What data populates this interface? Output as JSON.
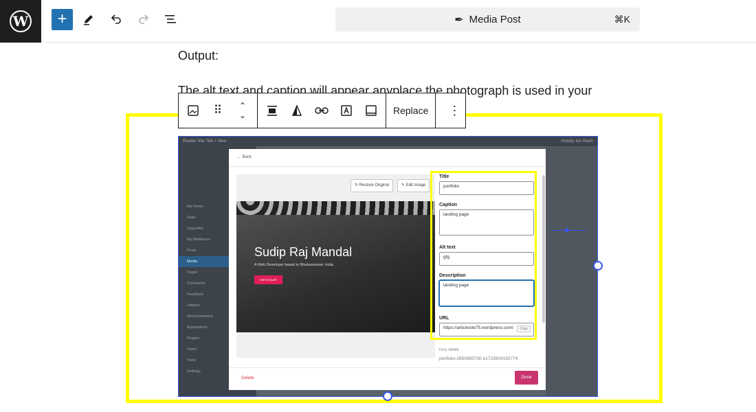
{
  "topbar": {
    "wp_logo": "W",
    "add_label": "+",
    "doc_title": "Media Post",
    "shortcut": "⌘K",
    "icons": [
      "wordpress-icon",
      "add-block-icon",
      "pencil-icon",
      "undo-icon",
      "redo-icon",
      "list-view-icon",
      "feather-icon"
    ]
  },
  "content": {
    "para1": "Output:",
    "para2": "The alt text and caption will appear anyplace the photograph is used in your"
  },
  "block_toolbar": {
    "replace_label": "Replace",
    "icons": [
      "image-icon",
      "drag-handle-icon",
      "move-up-icon",
      "move-down-icon",
      "align-icon",
      "duotone-icon",
      "link-icon",
      "text-overlay-icon",
      "crop-icon",
      "more-options-icon"
    ]
  },
  "screenshot": {
    "admin_bar": "Reader   Site Title   + New",
    "howdy": "Howdy, Ian Stach",
    "sidebar": [
      "My Home",
      "Stats",
      "Upgrades",
      "My Mailboxes",
      "Posts",
      "Media",
      "Pages",
      "Comments",
      "Feedback",
      "Jetpack",
      "WooCommerce",
      "Appearance",
      "Plugins",
      "Users",
      "Tools",
      "Settings"
    ],
    "sidebar_active": "Media",
    "back": "← Back",
    "restore_label": "Restore Original",
    "edit_label": "Edit Image",
    "hero_name": "Sudip Raj Mandal",
    "hero_role": "A Web Developer based in Bhubaneswar, India.",
    "hero_cta": "Get in touch",
    "fields": {
      "title_label": "Title",
      "title_value": "portfolio",
      "caption_label": "Caption",
      "caption_value": "landing page",
      "alt_label": "Alt text",
      "alt_value": "gfg",
      "desc_label": "Description",
      "desc_value": "landing page",
      "url_label": "URL",
      "url_value": "https://articlesite75.wordpress.com/",
      "copy_label": "Copy"
    },
    "file_name_label": "FILE NAME",
    "file_name_value": "portfolio-2850885730-e1723504150774",
    "delete_label": "Delete",
    "done_label": "Done"
  }
}
